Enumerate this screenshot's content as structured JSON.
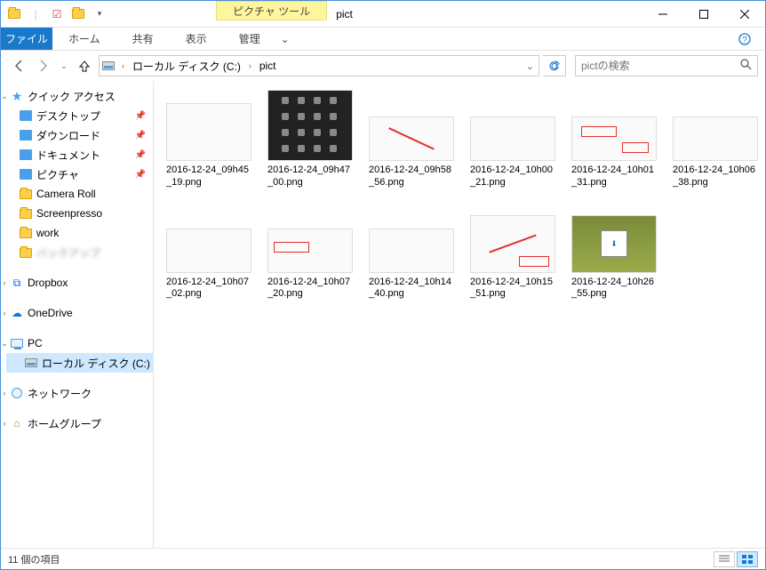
{
  "window": {
    "tool_tab": "ピクチャ ツール",
    "title": "pict"
  },
  "ribbon": {
    "file": "ファイル",
    "tabs": [
      "ホーム",
      "共有",
      "表示",
      "管理"
    ]
  },
  "nav": {
    "path_root": "ローカル ディスク (C:)",
    "path_leaf": "pict",
    "search_placeholder": "pictの検索"
  },
  "tree": {
    "quick_access": "クイック アクセス",
    "items": [
      {
        "label": "デスクトップ",
        "pinned": true,
        "icon": "desktop"
      },
      {
        "label": "ダウンロード",
        "pinned": true,
        "icon": "download"
      },
      {
        "label": "ドキュメント",
        "pinned": true,
        "icon": "document"
      },
      {
        "label": "ピクチャ",
        "pinned": true,
        "icon": "picture"
      },
      {
        "label": "Camera Roll",
        "pinned": false,
        "icon": "folder"
      },
      {
        "label": "Screenpresso",
        "pinned": false,
        "icon": "folder"
      },
      {
        "label": "work",
        "pinned": false,
        "icon": "folder"
      }
    ],
    "blurred_item": "バックアップ",
    "dropbox": "Dropbox",
    "onedrive": "OneDrive",
    "pc": "PC",
    "local_disk": "ローカル ディスク (C:)",
    "network": "ネットワーク",
    "homegroup": "ホームグループ"
  },
  "files": [
    {
      "name": "2016-12-24_09h45_19.png",
      "thumb": "light-text",
      "h": "medium"
    },
    {
      "name": "2016-12-24_09h47_00.png",
      "thumb": "dark-icons",
      "h": "full"
    },
    {
      "name": "2016-12-24_09h58_56.png",
      "thumb": "redline",
      "h": "small"
    },
    {
      "name": "2016-12-24_10h00_21.png",
      "thumb": "explorer",
      "h": "small"
    },
    {
      "name": "2016-12-24_10h01_31.png",
      "thumb": "explorer-red",
      "h": "small"
    },
    {
      "name": "2016-12-24_10h06_38.png",
      "thumb": "wide-bar",
      "h": "small"
    },
    {
      "name": "2016-12-24_10h07_02.png",
      "thumb": "wide-bar2",
      "h": "small"
    },
    {
      "name": "2016-12-24_10h07_20.png",
      "thumb": "dialog-red",
      "h": "small"
    },
    {
      "name": "2016-12-24_10h14_40.png",
      "thumb": "tiny",
      "h": "small"
    },
    {
      "name": "2016-12-24_10h15_51.png",
      "thumb": "menu-red",
      "h": "medium"
    },
    {
      "name": "2016-12-24_10h26_55.png",
      "thumb": "green",
      "h": "medium"
    }
  ],
  "status": {
    "count_text": "11 個の項目"
  }
}
